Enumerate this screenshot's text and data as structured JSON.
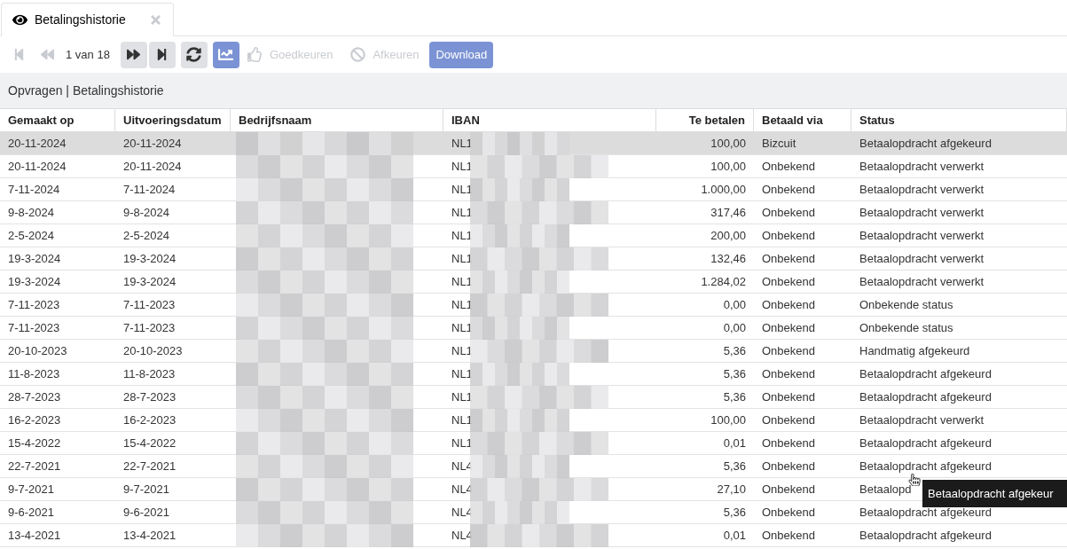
{
  "tab": {
    "label": "Betalingshistorie",
    "selected": true
  },
  "toolbar": [
    {
      "kind": "icon",
      "disabled": true
    },
    {
      "kind": "icon",
      "disabled": true
    },
    {
      "kind": "page",
      "text": "1 van 18"
    },
    {
      "kind": "icon",
      "disabled": false
    },
    {
      "kind": "icon",
      "disabled": false
    },
    {
      "kind": "icon",
      "disabled": false
    },
    {
      "kind": "toggle",
      "active": true
    },
    {
      "kind": "action",
      "label": "Goedkeuren",
      "disabled": true
    },
    {
      "kind": "action",
      "label": "Afkeuren",
      "disabled": true
    },
    {
      "kind": "primary",
      "label": "Download",
      "disabled": false
    }
  ],
  "breadcrumb": "Opvragen | Betalingshistorie",
  "table": {
    "columns": [
      "Gemaakt op",
      "Uitvoeringsdatum",
      "Bedrijfsnaam",
      "IBAN",
      "Te betalen",
      "Betaald via",
      "Status"
    ],
    "rows": [
      {
        "created": "20-11-2024",
        "executed": "20-11-2024",
        "iban": "NL1",
        "amount": "100,00",
        "via": "Bizcuit",
        "status": "Betaalopdracht afgekeurd",
        "selected": true
      },
      {
        "created": "20-11-2024",
        "executed": "20-11-2024",
        "iban": "NL1",
        "amount": "100,00",
        "via": "Onbekend",
        "status": "Betaalopdracht verwerkt",
        "selected": false
      },
      {
        "created": "7-11-2024",
        "executed": "7-11-2024",
        "iban": "NL1",
        "amount": "1.000,00",
        "via": "Onbekend",
        "status": "Betaalopdracht verwerkt",
        "selected": false
      },
      {
        "created": "9-8-2024",
        "executed": "9-8-2024",
        "iban": "NL1",
        "amount": "317,46",
        "via": "Onbekend",
        "status": "Betaalopdracht verwerkt",
        "selected": false
      },
      {
        "created": "2-5-2024",
        "executed": "2-5-2024",
        "iban": "NL1",
        "amount": "200,00",
        "via": "Onbekend",
        "status": "Betaalopdracht verwerkt",
        "selected": false
      },
      {
        "created": "19-3-2024",
        "executed": "19-3-2024",
        "iban": "NL1",
        "amount": "132,46",
        "via": "Onbekend",
        "status": "Betaalopdracht verwerkt",
        "selected": false
      },
      {
        "created": "19-3-2024",
        "executed": "19-3-2024",
        "iban": "NL1",
        "amount": "1.284,02",
        "via": "Onbekend",
        "status": "Betaalopdracht verwerkt",
        "selected": false
      },
      {
        "created": "7-11-2023",
        "executed": "7-11-2023",
        "iban": "NL1",
        "amount": "0,00",
        "via": "Onbekend",
        "status": "Onbekende status",
        "selected": false
      },
      {
        "created": "7-11-2023",
        "executed": "7-11-2023",
        "iban": "NL1",
        "amount": "0,00",
        "via": "Onbekend",
        "status": "Onbekende status",
        "selected": false
      },
      {
        "created": "20-10-2023",
        "executed": "20-10-2023",
        "iban": "NL1",
        "amount": "5,36",
        "via": "Onbekend",
        "status": "Handmatig afgekeurd",
        "selected": false
      },
      {
        "created": "11-8-2023",
        "executed": "11-8-2023",
        "iban": "NL1",
        "amount": "5,36",
        "via": "Onbekend",
        "status": "Betaalopdracht afgekeurd",
        "selected": false
      },
      {
        "created": "28-7-2023",
        "executed": "28-7-2023",
        "iban": "NL1",
        "amount": "5,36",
        "via": "Onbekend",
        "status": "Betaalopdracht afgekeurd",
        "selected": false
      },
      {
        "created": "16-2-2023",
        "executed": "16-2-2023",
        "iban": "NL1",
        "amount": "100,00",
        "via": "Onbekend",
        "status": "Betaalopdracht verwerkt",
        "selected": false
      },
      {
        "created": "15-4-2022",
        "executed": "15-4-2022",
        "iban": "NL1",
        "amount": "0,01",
        "via": "Onbekend",
        "status": "Betaalopdracht afgekeurd",
        "selected": false
      },
      {
        "created": "22-7-2021",
        "executed": "22-7-2021",
        "iban": "NL4",
        "amount": "5,36",
        "via": "Onbekend",
        "status": "Betaalopdracht afgekeurd",
        "selected": false
      },
      {
        "created": "9-7-2021",
        "executed": "9-7-2021",
        "iban": "NL4",
        "amount": "27,10",
        "via": "Onbekend",
        "status": "Betaalopd",
        "selected": false
      },
      {
        "created": "9-6-2021",
        "executed": "9-6-2021",
        "iban": "NL4",
        "amount": "5,36",
        "via": "Onbekend",
        "status": "Betaalopdracht afgekeurd",
        "selected": false
      },
      {
        "created": "13-4-2021",
        "executed": "13-4-2021",
        "iban": "NL4",
        "amount": "0,01",
        "via": "Onbekend",
        "status": "Betaalopdracht afgekeurd",
        "selected": false
      }
    ]
  },
  "tooltip": "Betaalopdracht afgekeur"
}
